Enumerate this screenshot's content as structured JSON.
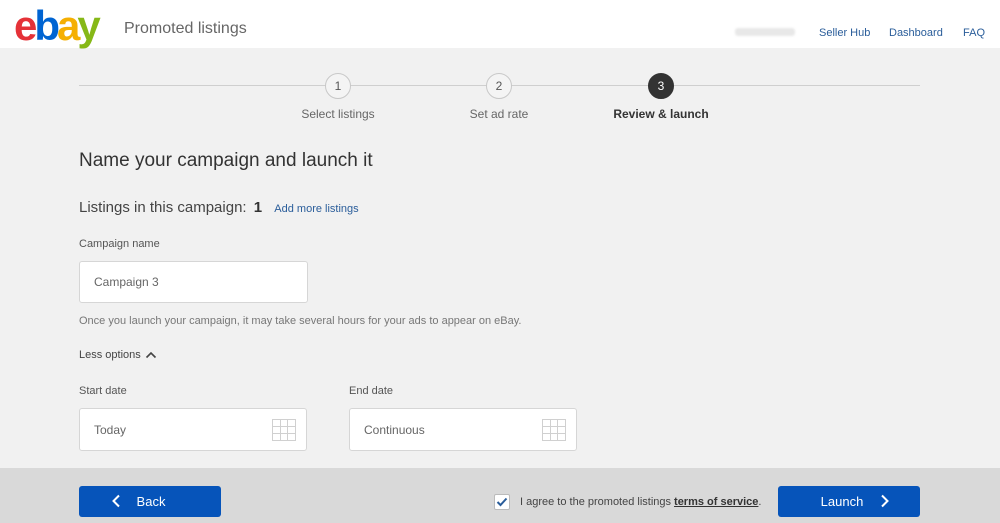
{
  "header": {
    "logo_letters": [
      "e",
      "b",
      "a",
      "y"
    ],
    "app_title": "Promoted listings",
    "nav": [
      "Seller Hub",
      "Dashboard",
      "FAQ"
    ]
  },
  "stepper": {
    "steps": [
      {
        "number": "1",
        "label": "Select listings"
      },
      {
        "number": "2",
        "label": "Set ad rate"
      },
      {
        "number": "3",
        "label": "Review & launch"
      }
    ],
    "active_step": 3
  },
  "main": {
    "title": "Name your campaign and launch it",
    "listings_label": "Listings in this campaign:",
    "listings_count": "1",
    "add_more_link": "Add more listings",
    "campaign_name_label": "Campaign name",
    "campaign_name_value": "Campaign 3",
    "helper_text": "Once you launch your campaign, it may take several hours for your ads to appear on eBay.",
    "less_options_label": "Less options",
    "start_date_label": "Start date",
    "start_date_value": "Today",
    "end_date_label": "End date",
    "end_date_value": "Continuous"
  },
  "footer": {
    "back_label": "Back",
    "agree_text": "I agree to the promoted listings",
    "tos_link": "terms of service",
    "agree_suffix": ".",
    "launch_label": "Launch",
    "agree_checked": true
  },
  "colors": {
    "primary_button": "#0654ba",
    "link": "#2a5d9a",
    "logo_e": "#e53238",
    "logo_b": "#0064d2",
    "logo_a": "#f5af02",
    "logo_y": "#86b817"
  }
}
